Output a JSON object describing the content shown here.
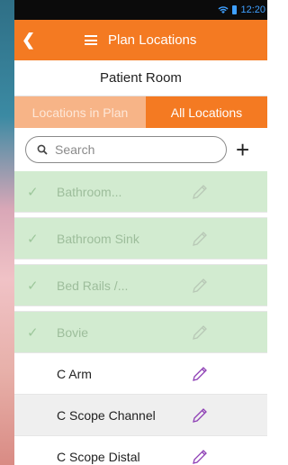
{
  "status_bar": {
    "time": "12:20"
  },
  "header": {
    "title": "Plan Locations"
  },
  "subtitle": "Patient Room",
  "tabs": [
    {
      "label": "Locations in Plan",
      "active": false
    },
    {
      "label": "All Locations",
      "active": true
    }
  ],
  "search": {
    "placeholder": "Search"
  },
  "items": [
    {
      "label": "Bathroom...",
      "selected": true
    },
    {
      "label": "Bathroom Sink",
      "selected": true
    },
    {
      "label": "Bed Rails /...",
      "selected": true
    },
    {
      "label": "Bovie",
      "selected": true
    },
    {
      "label": "C Arm",
      "selected": false
    },
    {
      "label": "C Scope Channel",
      "selected": false
    },
    {
      "label": "C Scope Distal",
      "selected": false
    }
  ],
  "colors": {
    "accent": "#f47a22",
    "selected_row": "#d2ebd0",
    "pencil_active": "#8e3fb5",
    "pencil_disabled": "#b8c8b6"
  },
  "icons": {
    "back": "chevron-left-icon",
    "menu": "hamburger-icon",
    "search": "search-icon",
    "add": "plus-icon",
    "check": "check-icon",
    "edit": "pencil-icon"
  }
}
